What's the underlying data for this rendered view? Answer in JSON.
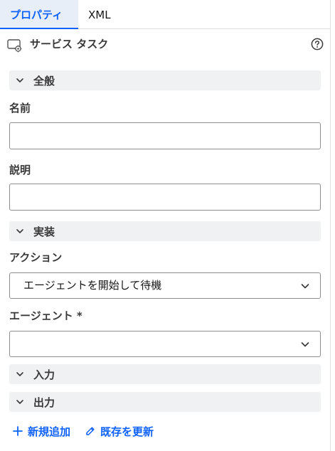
{
  "tabs": [
    {
      "label": "プロパティ",
      "active": true
    },
    {
      "label": "XML",
      "active": false
    }
  ],
  "header": {
    "icon": "service-task-gear-icon",
    "title": "サービス タスク",
    "help_icon": "help-circle-icon"
  },
  "sections": {
    "general": {
      "label": "全般",
      "expanded": true
    },
    "implementation": {
      "label": "実装",
      "expanded": true
    },
    "input": {
      "label": "入力",
      "expanded": true
    },
    "output": {
      "label": "出力",
      "expanded": true
    }
  },
  "fields": {
    "name": {
      "label": "名前",
      "value": ""
    },
    "description": {
      "label": "説明",
      "value": ""
    },
    "action": {
      "label": "アクション",
      "value": "エージェントを開始して待機"
    },
    "agent": {
      "label": "エージェント *",
      "value": ""
    }
  },
  "footer": {
    "add_new": {
      "label": "新規追加",
      "icon": "plus-icon"
    },
    "update_existing": {
      "label": "既存を更新",
      "icon": "edit-icon"
    }
  },
  "colors": {
    "accent": "#0f62fe",
    "section_bg": "#f0f1f3",
    "tab_active_bg": "#e8eef8",
    "input_border": "#8d8d8d"
  }
}
